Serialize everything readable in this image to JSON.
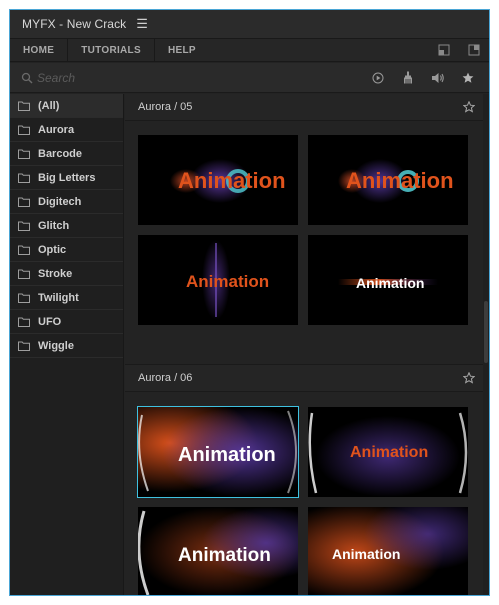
{
  "window": {
    "title": "MYFX - New Crack",
    "menu_icon": "hamburger-icon",
    "border_color": "#4aa6d6"
  },
  "nav": {
    "items": [
      {
        "label": "HOME"
      },
      {
        "label": "TUTORIALS"
      },
      {
        "label": "HELP"
      }
    ],
    "right_icons": [
      "panel-small-icon",
      "panel-expand-icon"
    ]
  },
  "search": {
    "placeholder": "Search",
    "value": "",
    "tools": [
      "play-icon",
      "brush-icon",
      "volume-icon",
      "star-icon"
    ]
  },
  "sidebar": {
    "items": [
      {
        "label": "(All)",
        "active": true
      },
      {
        "label": "Aurora"
      },
      {
        "label": "Barcode"
      },
      {
        "label": "Big Letters"
      },
      {
        "label": "Digitech"
      },
      {
        "label": "Glitch"
      },
      {
        "label": "Optic"
      },
      {
        "label": "Stroke"
      },
      {
        "label": "Twilight"
      },
      {
        "label": "UFO"
      },
      {
        "label": "Wiggle"
      }
    ]
  },
  "presets": [
    {
      "title": "Aurora / 05",
      "thumbs": [
        {
          "text": "Animation",
          "selected": false
        },
        {
          "text": "Animation",
          "selected": false
        },
        {
          "text": "Animation",
          "selected": false
        },
        {
          "text": "Animation",
          "selected": false
        }
      ]
    },
    {
      "title": "Aurora / 06",
      "thumbs": [
        {
          "text": "Animation",
          "selected": true
        },
        {
          "text": "Animation",
          "selected": false
        },
        {
          "text": "Animation",
          "selected": false
        },
        {
          "text": "Animation",
          "selected": false
        }
      ]
    }
  ],
  "colors": {
    "accent": "#3fc1e0",
    "orange": "#e0531c",
    "teal": "#4ec2c9",
    "purple": "#6c3fb0"
  }
}
